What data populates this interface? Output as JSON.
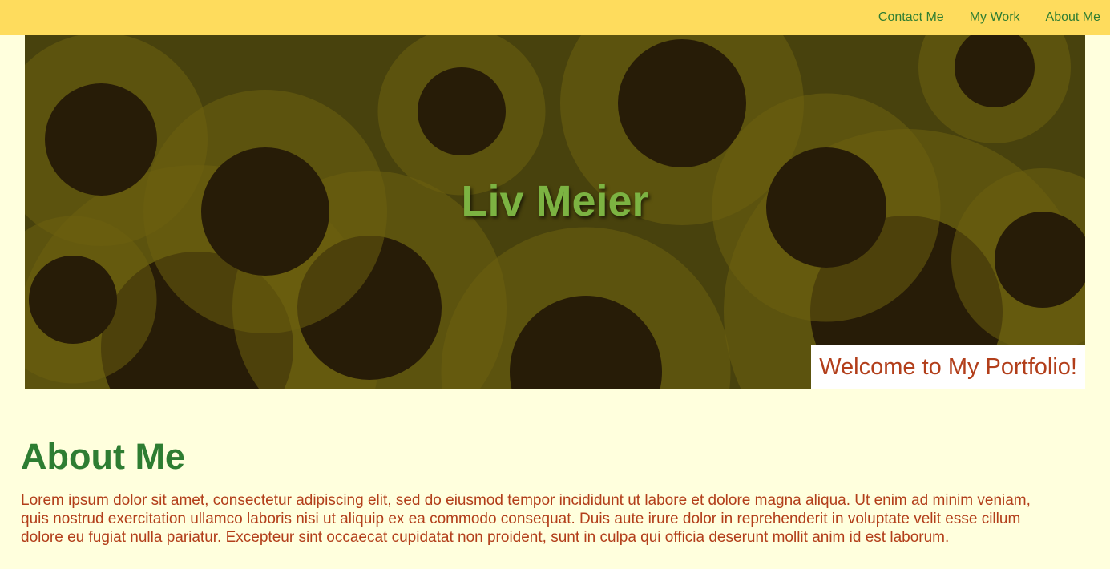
{
  "nav": {
    "items": [
      {
        "label": "Contact Me"
      },
      {
        "label": "My Work"
      },
      {
        "label": "About Me"
      }
    ]
  },
  "hero": {
    "title": "Liv Meier",
    "welcome": "Welcome to My Portfolio!",
    "image": "sunflower-field"
  },
  "about": {
    "heading": "About Me",
    "body": "Lorem ipsum dolor sit amet, consectetur adipiscing elit, sed do eiusmod tempor incididunt ut labore et dolore magna aliqua. Ut enim ad minim veniam, quis nostrud exercitation ullamco laboris nisi ut aliquip ex ea commodo consequat. Duis aute irure dolor in reprehenderit in voluptate velit esse cillum dolore eu fugiat nulla pariatur. Excepteur sint occaecat cupidatat non proident, sunt in culpa qui officia deserunt mollit anim id est laborum."
  },
  "colors": {
    "topbar": "#fedc5d",
    "page_background": "#ffffdd",
    "nav_link": "#2e7d32",
    "hero_title": "#7cb342",
    "welcome_text": "#b23e1a",
    "heading": "#2e7d32",
    "body_text": "#b23e1a"
  }
}
